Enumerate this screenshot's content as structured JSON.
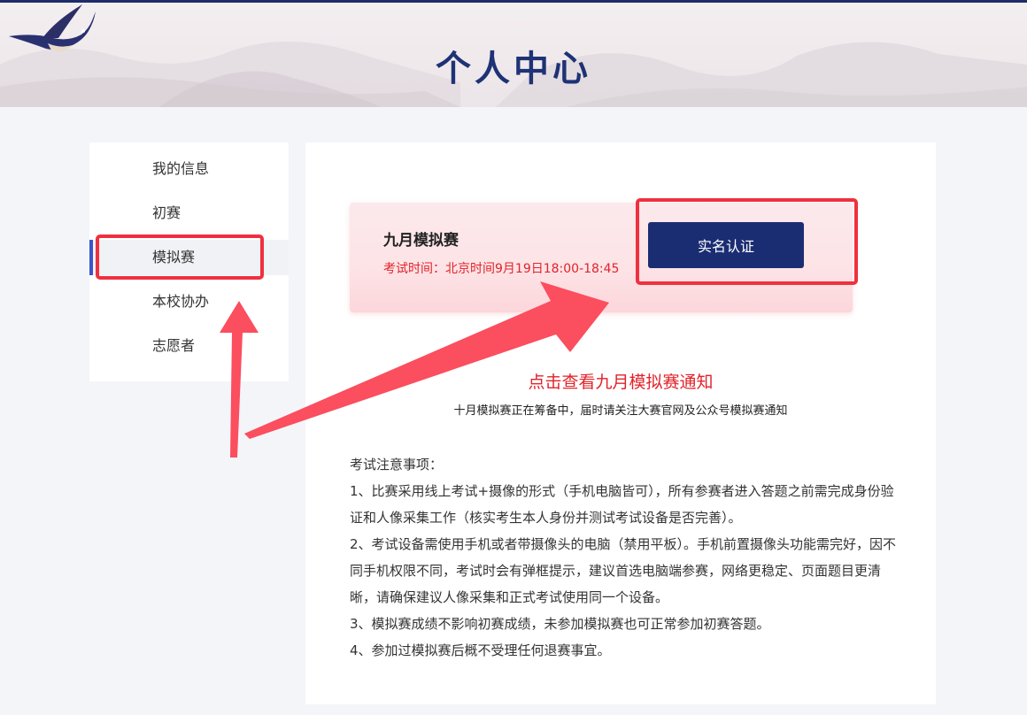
{
  "header": {
    "title": "个人中心"
  },
  "sidebar": {
    "items": [
      {
        "label": "我的信息",
        "active": false
      },
      {
        "label": "初赛",
        "active": false
      },
      {
        "label": "模拟赛",
        "active": true
      },
      {
        "label": "本校协办",
        "active": false
      },
      {
        "label": "志愿者",
        "active": false
      }
    ]
  },
  "exam_card": {
    "title": "九月模拟赛",
    "time": "考试时间：北京时间9月19日18:00-18:45",
    "button_label": "实名认证"
  },
  "notice": {
    "link_text": "点击查看九月模拟赛通知",
    "sub_text": "十月模拟赛正在筹备中，届时请关注大赛官网及公众号模拟赛通知"
  },
  "rules": {
    "heading": "考试注意事项：",
    "items": [
      "1、比赛采用线上考试+摄像的形式（手机电脑皆可），所有参赛者进入答题之前需完成身份验证和人像采集工作（核实考生本人身份并测试考试设备是否完善）。",
      "2、考试设备需使用手机或者带摄像头的电脑（禁用平板）。手机前置摄像头功能需完好，因不同手机权限不同，考试时会有弹框提示，建议首选电脑端参赛，网络更稳定、页面题目更清晰，请确保建议人像采集和正式考试使用同一个设备。",
      "3、模拟赛成绩不影响初赛成绩，未参加模拟赛也可正常参加初赛答题。",
      "4、参加过模拟赛后概不受理任何退赛事宜。"
    ]
  },
  "colors": {
    "brand_navy": "#1b2d72",
    "accent_red": "#e1232a",
    "annotation_red": "#f0303e",
    "active_marker": "#3b55c9"
  }
}
